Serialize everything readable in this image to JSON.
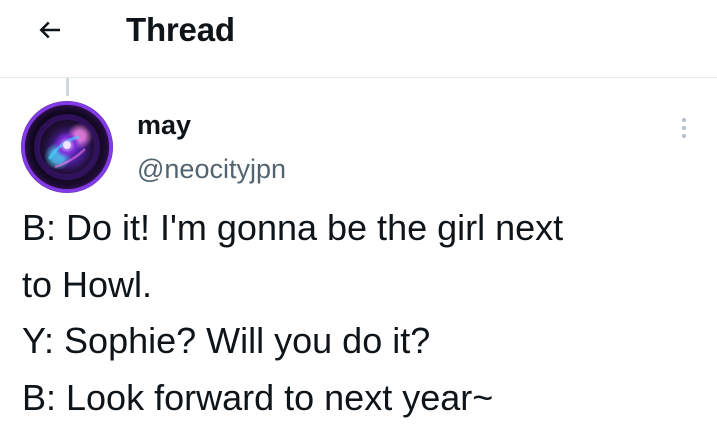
{
  "header": {
    "back_icon": "arrow-left-icon",
    "title": "Thread"
  },
  "tweet": {
    "author": {
      "display_name": "may",
      "handle": "@neocityjpn",
      "avatar": "avatar-image"
    },
    "more_icon": "more-vertical-icon",
    "lines": [
      "B: Do it! I'm gonna be the girl next",
      "to Howl.",
      "Y: Sophie? Will you do it?",
      "B: Look forward to next year~"
    ]
  },
  "colors": {
    "text": "#0f1419",
    "secondary_text": "#536471",
    "divider": "#e4e7ea",
    "more_dots": "#b6c0c8"
  }
}
